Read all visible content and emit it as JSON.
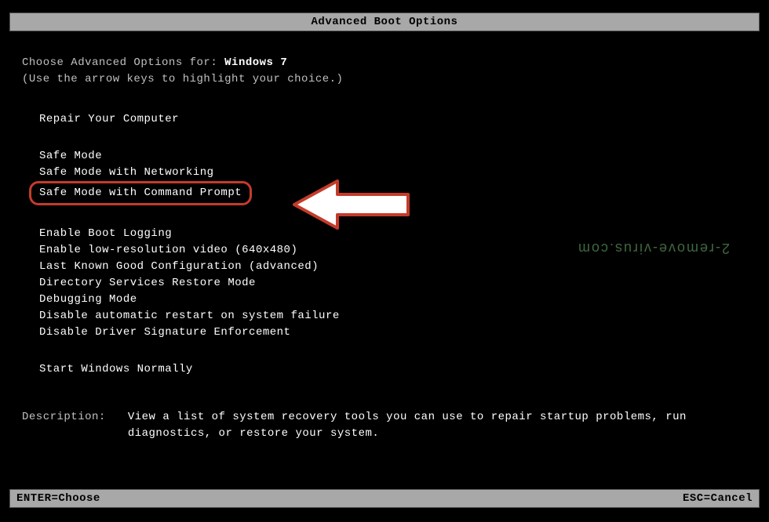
{
  "title": "Advanced Boot Options",
  "intro": {
    "prefix": "Choose Advanced Options for: ",
    "os": "Windows 7",
    "hint": "(Use the arrow keys to highlight your choice.)"
  },
  "menu": {
    "repair": "Repair Your Computer",
    "safe_mode": "Safe Mode",
    "safe_mode_net": "Safe Mode with Networking",
    "safe_mode_cmd": "Safe Mode with Command Prompt",
    "boot_logging": "Enable Boot Logging",
    "low_res": "Enable low-resolution video (640x480)",
    "last_known": "Last Known Good Configuration (advanced)",
    "ds_restore": "Directory Services Restore Mode",
    "debugging": "Debugging Mode",
    "disable_restart": "Disable automatic restart on system failure",
    "disable_sig": "Disable Driver Signature Enforcement",
    "start_normal": "Start Windows Normally"
  },
  "description": {
    "label": "Description:",
    "text": "View a list of system recovery tools you can use to repair startup problems, run diagnostics, or restore your system."
  },
  "footer": {
    "enter": "ENTER=Choose",
    "esc": "ESC=Cancel"
  },
  "watermark": "2-remove-virus.com",
  "colors": {
    "highlight_border": "#c43b2a",
    "watermark": "#4a7a4a",
    "bar_bg": "#a8a8a8"
  }
}
